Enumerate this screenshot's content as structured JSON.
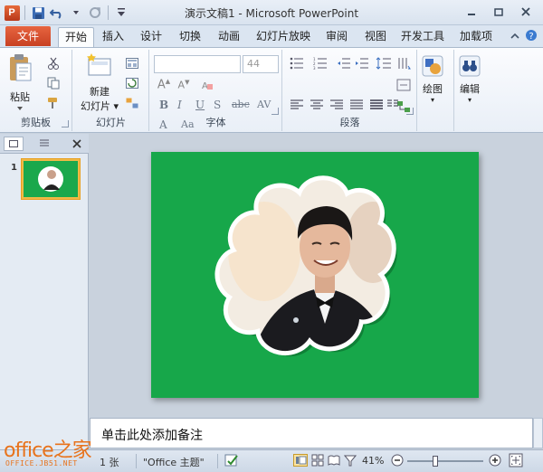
{
  "window": {
    "title": "演示文稿1 - Microsoft PowerPoint",
    "app_icon_letter": "P"
  },
  "tabs": {
    "file": "文件",
    "items": [
      "开始",
      "插入",
      "设计",
      "切换",
      "动画",
      "幻灯片放映",
      "审阅",
      "视图",
      "开发工具",
      "加载项"
    ],
    "active": "开始"
  },
  "ribbon": {
    "clipboard": {
      "paste_label": "粘贴",
      "group_label": "剪贴板"
    },
    "slides": {
      "new_slide_label_1": "新建",
      "new_slide_label_2": "幻灯片",
      "group_label": "幻灯片"
    },
    "font": {
      "font_name_value": "",
      "font_size_value": "44",
      "group_label": "字体"
    },
    "paragraph": {
      "group_label": "段落"
    },
    "drawing": {
      "label": "绘图"
    },
    "editing": {
      "label": "编辑"
    }
  },
  "slide_panel": {
    "thumbnail_number": "1"
  },
  "notes": {
    "placeholder": "单击此处添加备注"
  },
  "statusbar": {
    "slide_count": "1 张",
    "theme": "\"Office 主题\"",
    "zoom": "41%"
  },
  "watermark": {
    "main": "office之家",
    "sub": "OFFICE.JB51.NET"
  },
  "colors": {
    "slide_bg": "#17a74a",
    "file_tab": "#d24a27",
    "accent": "#f0b946"
  }
}
